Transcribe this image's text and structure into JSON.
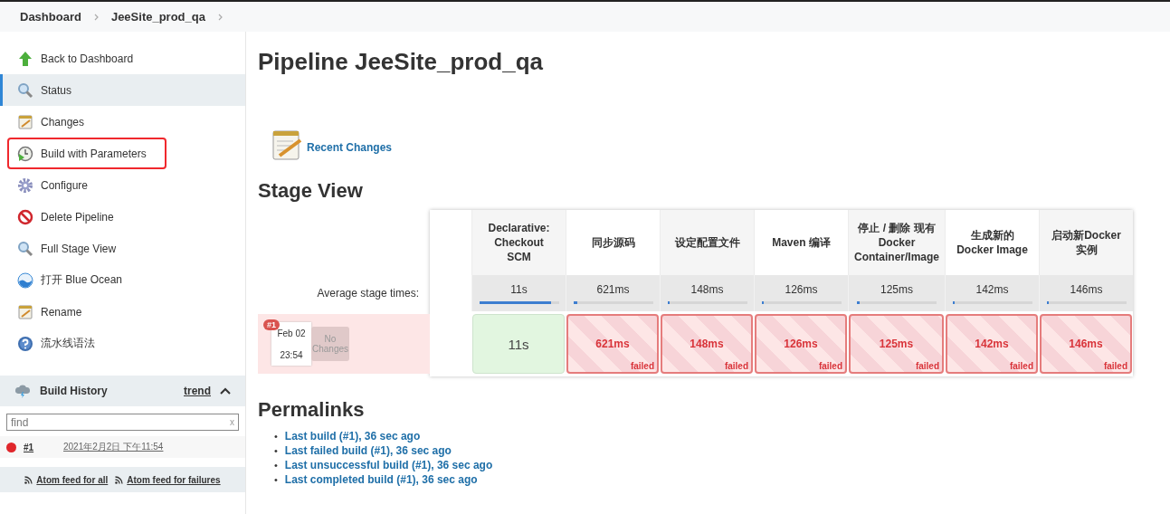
{
  "breadcrumbs": [
    {
      "label": "Dashboard"
    },
    {
      "label": "JeeSite_prod_qa"
    }
  ],
  "sidebar": {
    "items": [
      {
        "label": "Back to Dashboard",
        "kind": "arrow",
        "selected": false,
        "highlighted": false
      },
      {
        "label": "Status",
        "kind": "search",
        "selected": true,
        "highlighted": false
      },
      {
        "label": "Changes",
        "kind": "notepad",
        "selected": false,
        "highlighted": false
      },
      {
        "label": "Build with Parameters",
        "kind": "clock",
        "selected": false,
        "highlighted": true
      },
      {
        "label": "Configure",
        "kind": "gear",
        "selected": false,
        "highlighted": false
      },
      {
        "label": "Delete Pipeline",
        "kind": "forbidden",
        "selected": false,
        "highlighted": false
      },
      {
        "label": "Full Stage View",
        "kind": "search",
        "selected": false,
        "highlighted": false
      },
      {
        "label": "打开 Blue Ocean",
        "kind": "ocean",
        "selected": false,
        "highlighted": false
      },
      {
        "label": "Rename",
        "kind": "notepad",
        "selected": false,
        "highlighted": false
      },
      {
        "label": "流水线语法",
        "kind": "help",
        "selected": false,
        "highlighted": false
      }
    ]
  },
  "build_history": {
    "title": "Build History",
    "trend": "trend",
    "expanded": true,
    "search": {
      "placeholder": "find",
      "clear": "x"
    },
    "builds": [
      {
        "number": "#1",
        "date": "2021年2月2日 下午11:54",
        "color": "#e0262b"
      }
    ],
    "feeds": [
      "Atom feed for all",
      "Atom feed for failures"
    ]
  },
  "main": {
    "title": "Pipeline JeeSite_prod_qa",
    "recent_changes": "Recent Changes",
    "stage_view": {
      "title": "Stage View",
      "average_label": "Average stage times:",
      "build": {
        "badge": "#1",
        "date": "Feb 02",
        "time": "23:54",
        "changes": "No Changes"
      },
      "stages": [
        {
          "name": "Declarative:\nCheckout\nSCM",
          "average": "11s",
          "level": 0.9,
          "duration": "11s",
          "kind": "success"
        },
        {
          "name": "同步源码",
          "average": "621ms",
          "level": 0.05,
          "duration": "621ms",
          "kind": "failed",
          "status_text": "failed"
        },
        {
          "name": "设定配置文件",
          "average": "148ms",
          "level": 0.03,
          "duration": "148ms",
          "kind": "failed",
          "status_text": "failed"
        },
        {
          "name": "Maven 编译",
          "average": "126ms",
          "level": 0.03,
          "duration": "126ms",
          "kind": "failed",
          "status_text": "failed"
        },
        {
          "name": "停止 / 删除 现有\nDocker\nContainer/Image",
          "average": "125ms",
          "level": 0.03,
          "duration": "125ms",
          "kind": "failed",
          "status_text": "failed"
        },
        {
          "name": "生成新的\nDocker Image",
          "average": "142ms",
          "level": 0.03,
          "duration": "142ms",
          "kind": "failed",
          "status_text": "failed"
        },
        {
          "name": "启动新Docker\n实例",
          "average": "146ms",
          "level": 0.03,
          "duration": "146ms",
          "kind": "failed",
          "status_text": "failed"
        }
      ]
    },
    "permalinks": {
      "title": "Permalinks",
      "links": [
        {
          "bullet": "•",
          "text": "Last build (#1), 36 sec ago"
        },
        {
          "bullet": "•",
          "text": "Last failed build (#1), 36 sec ago"
        },
        {
          "bullet": "•",
          "text": "Last unsuccessful build (#1), 36 sec ago"
        },
        {
          "bullet": "•",
          "text": "Last completed build (#1), 36 sec ago"
        }
      ]
    }
  }
}
